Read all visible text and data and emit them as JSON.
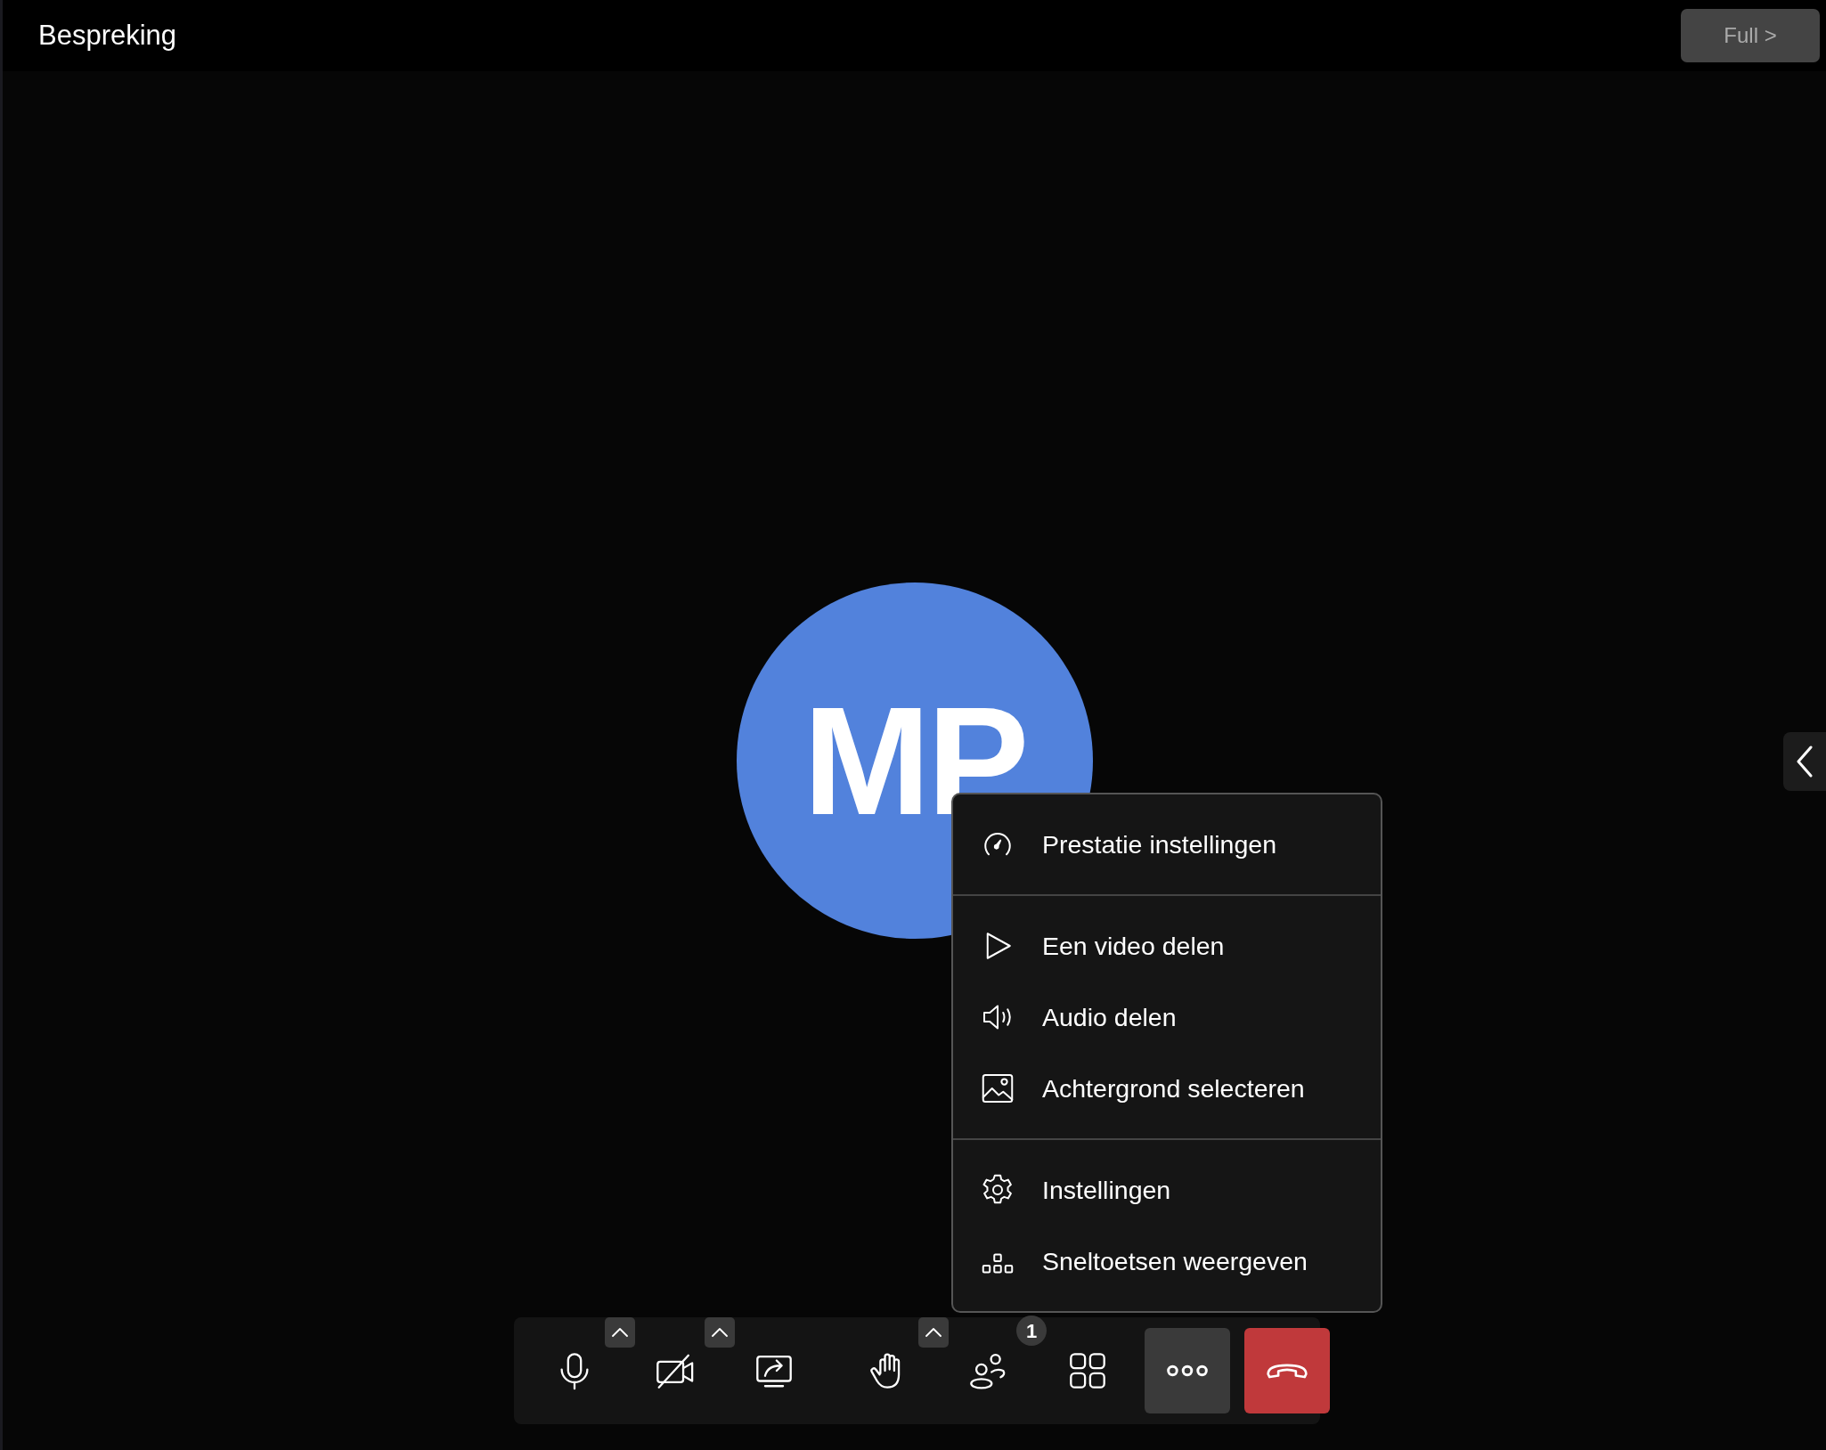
{
  "window": {
    "title": "Bespreking"
  },
  "full_button": {
    "label": "Full >"
  },
  "avatar": {
    "initials": "MP"
  },
  "menu": {
    "sections": [
      {
        "items": [
          {
            "kind": "gauge",
            "label": "Prestatie instellingen"
          }
        ]
      },
      {
        "items": [
          {
            "kind": "play",
            "label": "Een video delen"
          },
          {
            "kind": "speaker",
            "label": "Audio delen"
          },
          {
            "kind": "image",
            "label": "Achtergrond selecteren"
          }
        ]
      },
      {
        "items": [
          {
            "kind": "gear",
            "label": "Instellingen"
          },
          {
            "kind": "keys",
            "label": "Sneltoetsen weergeven"
          }
        ]
      }
    ]
  },
  "toolbar": {
    "buttons": [
      {
        "kind": "mic",
        "caret": true,
        "active": false
      },
      {
        "kind": "camera-off",
        "caret": true,
        "active": false
      },
      {
        "kind": "share",
        "caret": false,
        "active": false
      },
      {
        "kind": "hand",
        "caret": true,
        "active": false
      },
      {
        "kind": "people",
        "caret": false,
        "active": false,
        "badge": "1"
      },
      {
        "kind": "grid",
        "caret": false,
        "active": false
      },
      {
        "kind": "more",
        "caret": false,
        "active": true
      },
      {
        "kind": "hangup",
        "caret": false,
        "active": false
      }
    ]
  }
}
